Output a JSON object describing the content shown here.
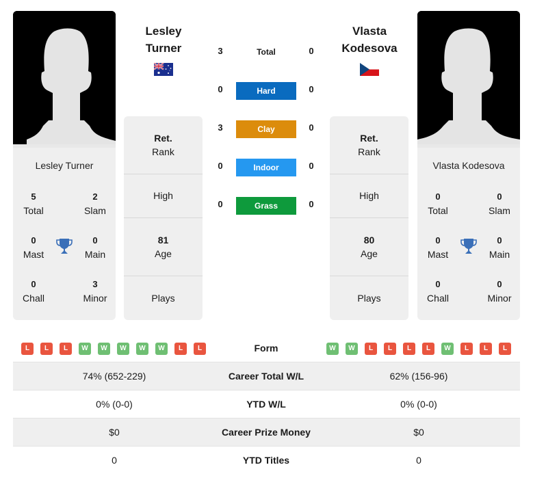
{
  "players": {
    "left": {
      "name_line1": "Lesley",
      "name_line2": "Turner",
      "full_name": "Lesley Turner",
      "flag": "australia-flag",
      "titles": {
        "total": "5",
        "slam": "2",
        "mast": "0",
        "main": "0",
        "chall": "0",
        "minor": "3"
      },
      "rank_value": "Ret.",
      "rank_label": "Rank",
      "high_label": "High",
      "age_value": "81",
      "age_label": "Age",
      "plays_label": "Plays",
      "form": [
        "L",
        "L",
        "L",
        "W",
        "W",
        "W",
        "W",
        "W",
        "L",
        "L"
      ]
    },
    "right": {
      "name_line1": "Vlasta",
      "name_line2": "Kodesova",
      "full_name": "Vlasta Kodesova",
      "flag": "czech-flag",
      "titles": {
        "total": "0",
        "slam": "0",
        "mast": "0",
        "main": "0",
        "chall": "0",
        "minor": "0"
      },
      "rank_value": "Ret.",
      "rank_label": "Rank",
      "high_label": "High",
      "age_value": "80",
      "age_label": "Age",
      "plays_label": "Plays",
      "form": [
        "W",
        "W",
        "L",
        "L",
        "L",
        "L",
        "W",
        "L",
        "L",
        "L"
      ]
    }
  },
  "title_labels": {
    "total": "Total",
    "slam": "Slam",
    "mast": "Mast",
    "main": "Main",
    "chall": "Chall",
    "minor": "Minor"
  },
  "h2h": {
    "total_label": "Total",
    "total_left": "3",
    "total_right": "0",
    "surfaces": [
      {
        "label": "Hard",
        "left": "0",
        "right": "0",
        "color": "#0a6bbf"
      },
      {
        "label": "Clay",
        "left": "3",
        "right": "0",
        "color": "#dc8c0c"
      },
      {
        "label": "Indoor",
        "left": "0",
        "right": "0",
        "color": "#2598f0"
      },
      {
        "label": "Grass",
        "left": "0",
        "right": "0",
        "color": "#0e9a3c"
      }
    ]
  },
  "form_label": "Form",
  "stats": [
    {
      "label": "Career Total W/L",
      "left": "74% (652-229)",
      "right": "62% (156-96)"
    },
    {
      "label": "YTD W/L",
      "left": "0% (0-0)",
      "right": "0% (0-0)"
    },
    {
      "label": "Career Prize Money",
      "left": "$0",
      "right": "$0"
    },
    {
      "label": "YTD Titles",
      "left": "0",
      "right": "0"
    }
  ],
  "colors": {
    "win": "#6fbf73",
    "loss": "#e9553f",
    "trophy": "#3a6fb8"
  }
}
